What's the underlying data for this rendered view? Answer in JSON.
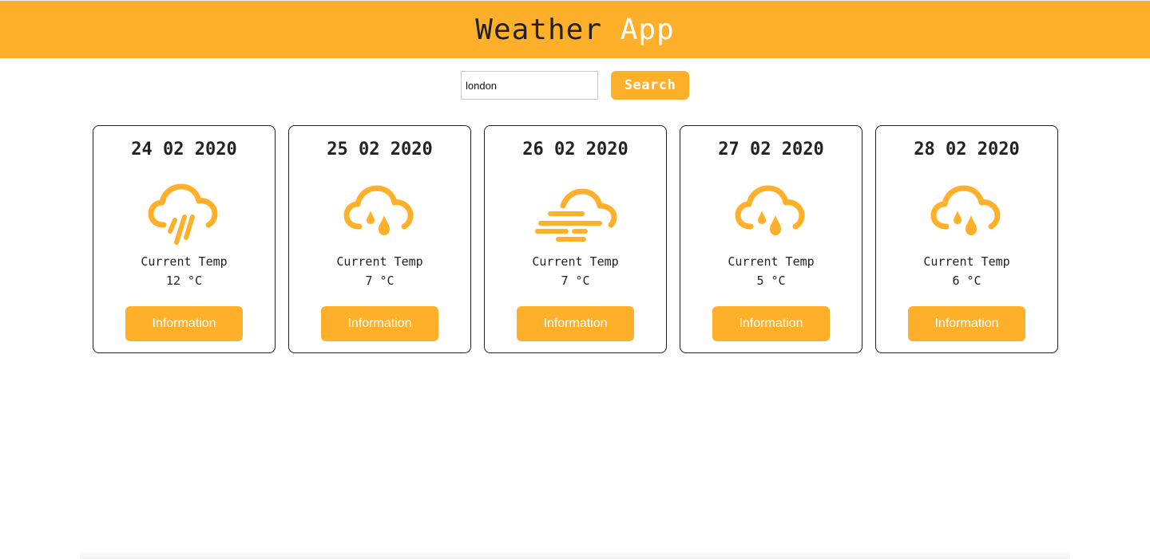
{
  "header": {
    "title_main": "Weather",
    "title_accent": "App"
  },
  "search": {
    "value": "london",
    "button_label": "Search"
  },
  "colors": {
    "accent": "#ffb02a",
    "text": "#222222"
  },
  "cards": [
    {
      "date": "24 02 2020",
      "icon": "rain-icon",
      "label": "Current Temp",
      "temp": "12 °C",
      "button_label": "Information"
    },
    {
      "date": "25 02 2020",
      "icon": "drizzle-icon",
      "label": "Current Temp",
      "temp": "7 °C",
      "button_label": "Information"
    },
    {
      "date": "26 02 2020",
      "icon": "wind-cloud-icon",
      "label": "Current Temp",
      "temp": "7 °C",
      "button_label": "Information"
    },
    {
      "date": "27 02 2020",
      "icon": "drizzle-icon",
      "label": "Current Temp",
      "temp": "5 °C",
      "button_label": "Information"
    },
    {
      "date": "28 02 2020",
      "icon": "drizzle-icon",
      "label": "Current Temp",
      "temp": "6 °C",
      "button_label": "Information"
    }
  ]
}
